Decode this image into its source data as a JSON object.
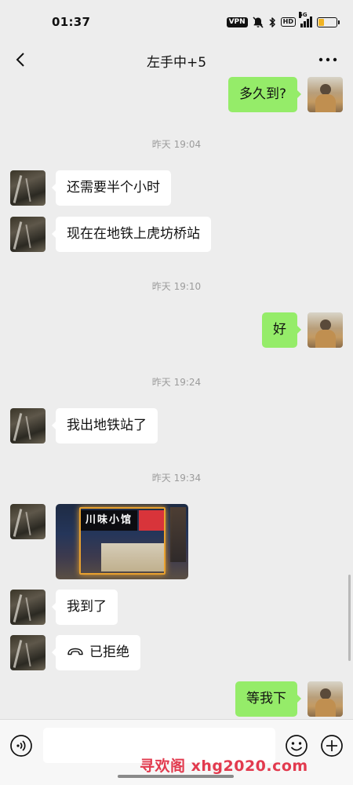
{
  "status_bar": {
    "time": "01:37",
    "vpn_label": "VPN",
    "hd_label": "HD",
    "network_label": "5G",
    "battery_level": 0.3,
    "icons": [
      "vpn-icon",
      "mute-bell-icon",
      "bluetooth-icon",
      "hd-icon",
      "signal-icon",
      "battery-icon"
    ]
  },
  "header": {
    "back_icon": "chevron-left-icon",
    "title": "左手中+5",
    "more_icon": "more-dots-icon"
  },
  "messages": [
    {
      "type": "text",
      "from": "me",
      "text": "多久到?"
    },
    {
      "type": "timestamp",
      "text": "昨天 19:04"
    },
    {
      "type": "text",
      "from": "friend",
      "text": "还需要半个小时"
    },
    {
      "type": "text",
      "from": "friend",
      "text": "现在在地铁上虎坊桥站"
    },
    {
      "type": "timestamp",
      "text": "昨天 19:10"
    },
    {
      "type": "text",
      "from": "me",
      "text": "好"
    },
    {
      "type": "timestamp",
      "text": "昨天 19:24"
    },
    {
      "type": "text",
      "from": "friend",
      "text": "我出地铁站了"
    },
    {
      "type": "timestamp",
      "text": "昨天 19:34"
    },
    {
      "type": "image",
      "from": "friend",
      "sign_text": "川味小馆"
    },
    {
      "type": "text",
      "from": "friend",
      "text": "我到了"
    },
    {
      "type": "call",
      "from": "friend",
      "icon": "phone-hangup-icon",
      "text": "已拒绝"
    },
    {
      "type": "text",
      "from": "me",
      "text": "等我下"
    }
  ],
  "input_bar": {
    "voice_icon": "voice-icon",
    "placeholder": "",
    "emoji_icon": "emoji-icon",
    "plus_icon": "plus-icon"
  },
  "watermark": "寻欢阁 xhg2020.com",
  "colors": {
    "background": "#ededed",
    "my_bubble": "#95ec69",
    "friend_bubble": "#ffffff",
    "timestamp_text": "#9c9c9c",
    "watermark": "#e23a4e",
    "battery": "#f0b323"
  }
}
